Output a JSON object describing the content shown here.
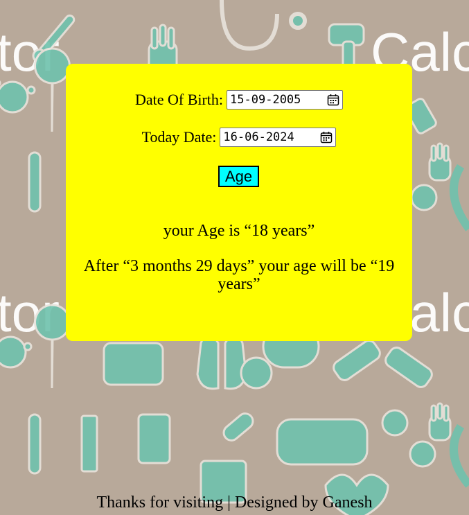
{
  "background": {
    "color": "#b8a99a",
    "icon_color": "#6fc2ad",
    "watermark_words": [
      "tor",
      "Calc",
      "tor",
      "Calc"
    ],
    "icons": [
      "thermometer-icon",
      "hand-icon",
      "stethoscope-icon",
      "virus-icon",
      "location-cross-icon",
      "test-tube-icon",
      "pill-icon",
      "awareness-ribbon-icon",
      "first-aid-kit-icon",
      "lungs-icon",
      "bandage-icon",
      "syringe-icon",
      "medicine-bottle-icon",
      "face-mask-icon",
      "heart-icon"
    ]
  },
  "form": {
    "card_color": "#ffff00",
    "dob_label": "Date Of Birth:",
    "dob_value": "15-09-2005",
    "today_label": "Today Date:",
    "today_value": "16-06-2024",
    "age_button_label": "Age",
    "age_button_color": "#00ffff"
  },
  "result": {
    "age_line": "your Age is “18 years”",
    "next_line": "After “3 months 29 days” your age will be “19 years”"
  },
  "footer": {
    "text": "Thanks for visiting | Designed by Ganesh"
  }
}
